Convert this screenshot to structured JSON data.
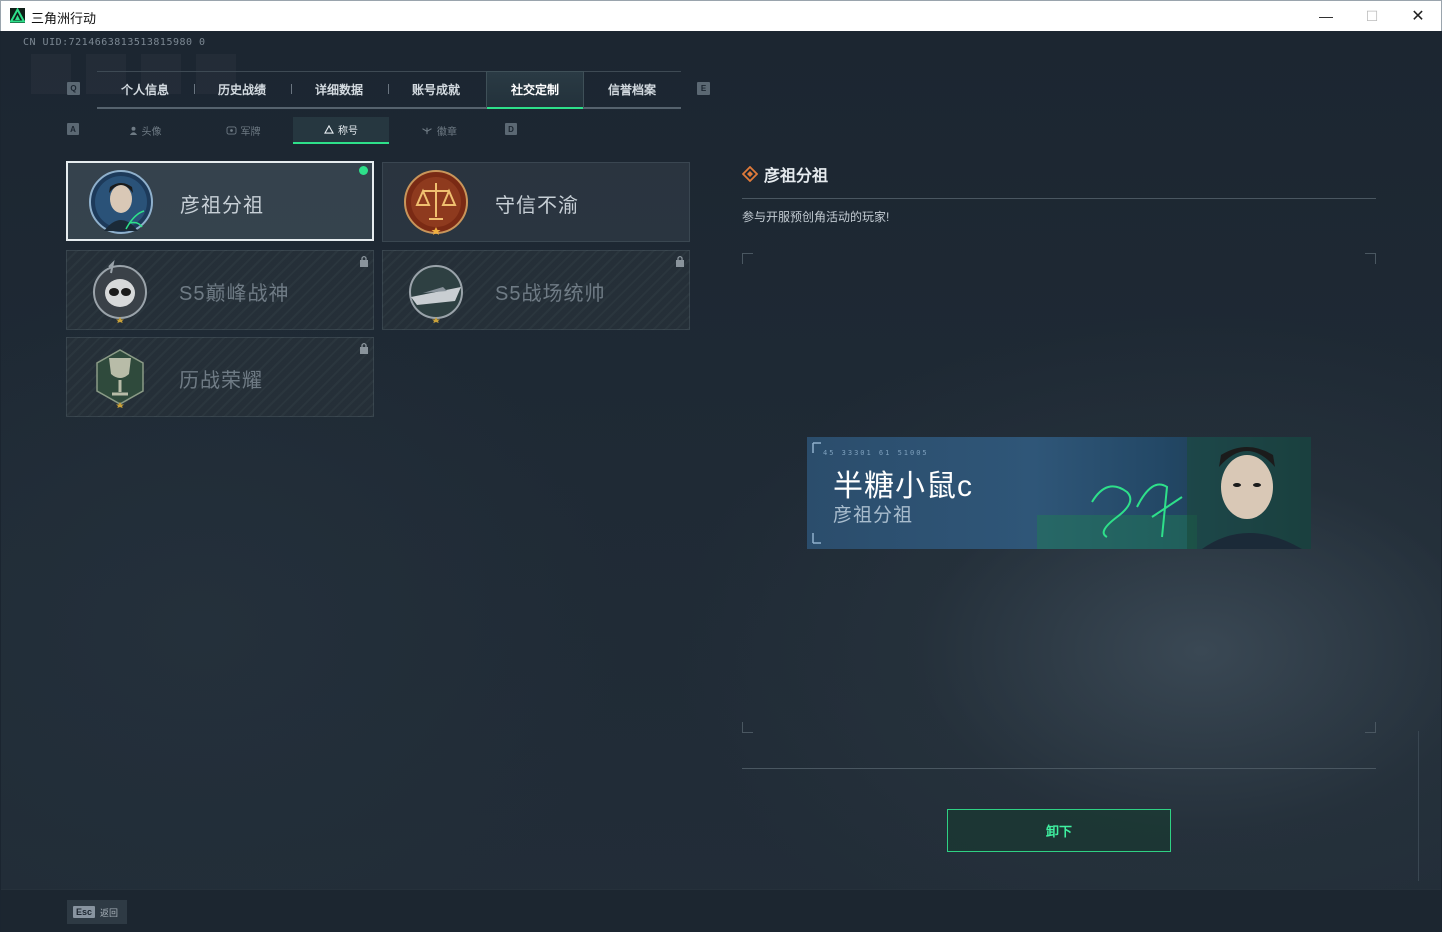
{
  "window": {
    "title": "三角洲行动"
  },
  "uid": "CN UID:7214663813513815980 0",
  "main_tabs": [
    {
      "label": "个人信息"
    },
    {
      "label": "历史战绩"
    },
    {
      "label": "详细数据"
    },
    {
      "label": "账号成就"
    },
    {
      "label": "社交定制",
      "active": true
    },
    {
      "label": "信誉档案"
    }
  ],
  "tab_keys": {
    "left": "Q",
    "right": "E"
  },
  "sub_tabs": [
    {
      "label": "头像",
      "icon": "person-icon"
    },
    {
      "label": "军牌",
      "icon": "dogtag-icon"
    },
    {
      "label": "称号",
      "icon": "triangle-icon",
      "active": true
    },
    {
      "label": "徽章",
      "icon": "wings-icon"
    }
  ],
  "sub_tab_keys": {
    "left": "A",
    "right": "D"
  },
  "titles": [
    {
      "name": "彦祖分祖",
      "selected": true,
      "equipped": true,
      "locked": false,
      "badge": "portrait-badge-icon"
    },
    {
      "name": "守信不渝",
      "selected": false,
      "equipped": false,
      "locked": false,
      "badge": "scales-badge-icon"
    },
    {
      "name": "S5巅峰战神",
      "selected": false,
      "equipped": false,
      "locked": true,
      "badge": "skull-badge-icon"
    },
    {
      "name": "S5战场统帅",
      "selected": false,
      "equipped": false,
      "locked": true,
      "badge": "boat-badge-icon"
    },
    {
      "name": "历战荣耀",
      "selected": false,
      "equipped": false,
      "locked": true,
      "badge": "trophy-badge-icon"
    }
  ],
  "detail": {
    "title": "彦祖分祖",
    "description": "参与开服预创角活动的玩家!",
    "banner": {
      "player_name": "半糖小鼠c",
      "title_name": "彦祖分祖",
      "code": "45 33301 61 51005"
    },
    "action_label": "卸下"
  },
  "footer": {
    "key": "Esc",
    "label": "返回"
  },
  "colors": {
    "accent": "#2ee08a",
    "background": "#1b2530"
  }
}
